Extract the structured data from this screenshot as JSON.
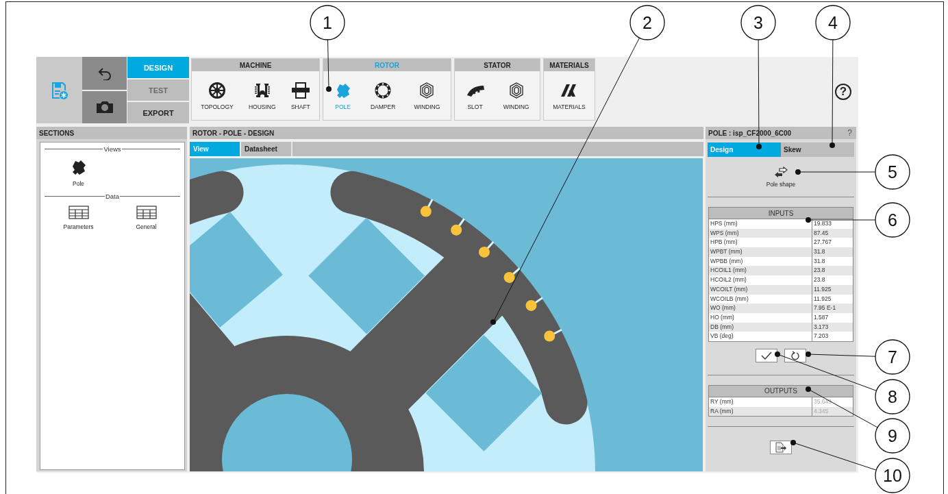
{
  "callouts": [
    {
      "label": "1"
    },
    {
      "label": "2"
    },
    {
      "label": "3"
    },
    {
      "label": "4"
    },
    {
      "label": "5"
    },
    {
      "label": "6"
    },
    {
      "label": "7"
    },
    {
      "label": "8"
    },
    {
      "label": "9"
    },
    {
      "label": "10"
    }
  ],
  "toolbar": {
    "modes": [
      {
        "label": "DESIGN",
        "selected": true,
        "disabled": false
      },
      {
        "label": "TEST",
        "selected": false,
        "disabled": true
      },
      {
        "label": "EXPORT",
        "selected": false,
        "disabled": false
      }
    ],
    "groups": [
      {
        "title": "MACHINE",
        "selected": false,
        "items": [
          {
            "label": "TOPOLOGY",
            "kind": "topology",
            "selected": false
          },
          {
            "label": "HOUSING",
            "kind": "housing",
            "selected": false
          },
          {
            "label": "SHAFT",
            "kind": "shaft",
            "selected": false
          }
        ]
      },
      {
        "title": "ROTOR",
        "selected": true,
        "items": [
          {
            "label": "POLE",
            "kind": "pole",
            "selected": true
          },
          {
            "label": "DAMPER",
            "kind": "damper",
            "selected": false
          },
          {
            "label": "WINDING",
            "kind": "winding",
            "selected": false
          }
        ]
      },
      {
        "title": "STATOR",
        "selected": false,
        "items": [
          {
            "label": "SLOT",
            "kind": "slot",
            "selected": false
          },
          {
            "label": "WINDING",
            "kind": "winding",
            "selected": false
          }
        ]
      },
      {
        "title": "MATERIALS",
        "selected": false,
        "items": [
          {
            "label": "MATERIALS",
            "kind": "materials",
            "selected": false
          }
        ]
      }
    ],
    "help": "?"
  },
  "sections": {
    "title": "SECTIONS",
    "groups": [
      {
        "title": "Views",
        "items": [
          {
            "label": "Pole",
            "kind": "pole"
          }
        ]
      },
      {
        "title": "Data",
        "items": [
          {
            "label": "Parameters",
            "kind": "table"
          },
          {
            "label": "General",
            "kind": "table"
          }
        ]
      }
    ]
  },
  "view": {
    "title": "ROTOR - POLE - DESIGN",
    "tabs": [
      {
        "label": "View",
        "selected": true
      },
      {
        "label": "Datasheet",
        "selected": false
      }
    ]
  },
  "properties": {
    "title": "POLE : isp_CF2000_6C00",
    "help": "?",
    "tabs": [
      {
        "label": "Design",
        "selected": true
      },
      {
        "label": "Skew",
        "selected": false
      }
    ],
    "shape_button": "Pole shape",
    "inputs": {
      "title": "INPUTS",
      "readonly": false,
      "rows": [
        {
          "name": "HPS (mm)",
          "value": "19.833"
        },
        {
          "name": "WPS (mm)",
          "value": "87.45"
        },
        {
          "name": "HPB (mm)",
          "value": "27.767"
        },
        {
          "name": "WPBT (mm)",
          "value": "31.8"
        },
        {
          "name": "WPBB (mm)",
          "value": "31.8"
        },
        {
          "name": "HCOIL1 (mm)",
          "value": "23.8"
        },
        {
          "name": "HCOIL2 (mm)",
          "value": "23.8"
        },
        {
          "name": "WCOILT (mm)",
          "value": "11.925"
        },
        {
          "name": "WCOILB (mm)",
          "value": "11.925"
        },
        {
          "name": "WO (mm)",
          "value": "7.95 E-1"
        },
        {
          "name": "HO (mm)",
          "value": "1.587"
        },
        {
          "name": "DB (mm)",
          "value": "3.173"
        },
        {
          "name": "VB (deg)",
          "value": "7.203"
        }
      ]
    },
    "outputs": {
      "title": "OUTPUTS",
      "readonly": true,
      "rows": [
        {
          "name": "RY (mm)",
          "value": "35.643"
        },
        {
          "name": "RA (mm)",
          "value": "4.345"
        }
      ]
    }
  }
}
